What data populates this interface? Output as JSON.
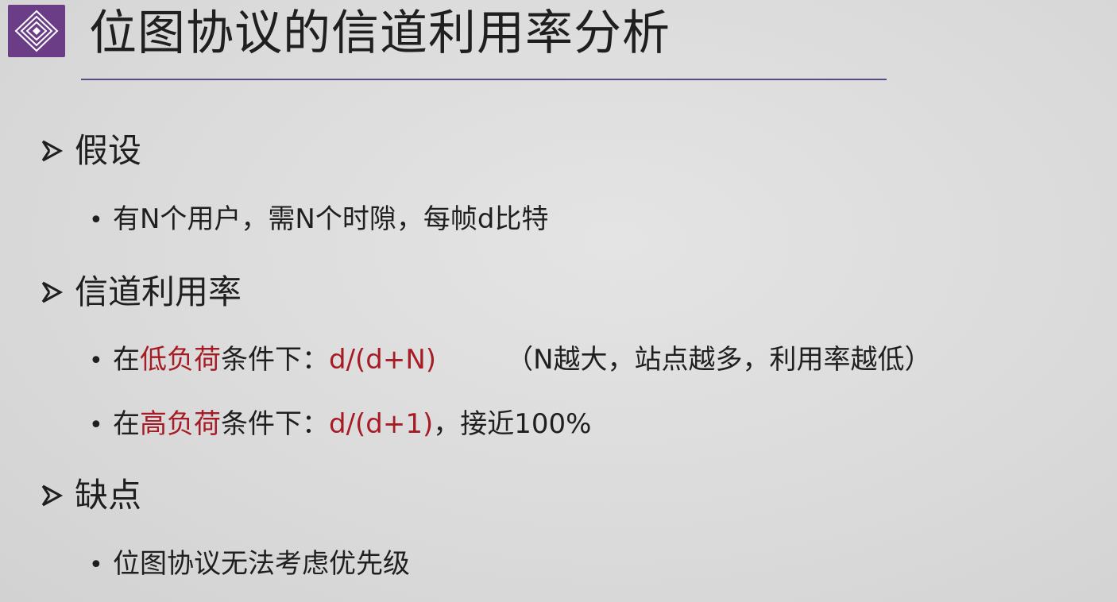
{
  "slide": {
    "title": "位图协议的信道利用率分析",
    "logo_icon": "concentric-diamond-logo-icon",
    "accent_color": "#6a3d86",
    "highlight_color": "#a61b24"
  },
  "sections": {
    "assumption": {
      "heading": "假设",
      "bullet_1": "有N个用户，需N个时隙，每帧d比特"
    },
    "utilization": {
      "heading": "信道利用率",
      "low": {
        "prefix": "在",
        "load": "低负荷",
        "condition": "条件下：",
        "formula": "d/(d+N)",
        "note": "（N越大，站点越多，利用率越低）"
      },
      "high": {
        "prefix": "在",
        "load": "高负荷",
        "condition": "条件下：",
        "formula": "d/(d+1)",
        "tail": "，接近100%"
      }
    },
    "drawback": {
      "heading": "缺点",
      "bullet_1": "位图协议无法考虑优先级"
    }
  }
}
